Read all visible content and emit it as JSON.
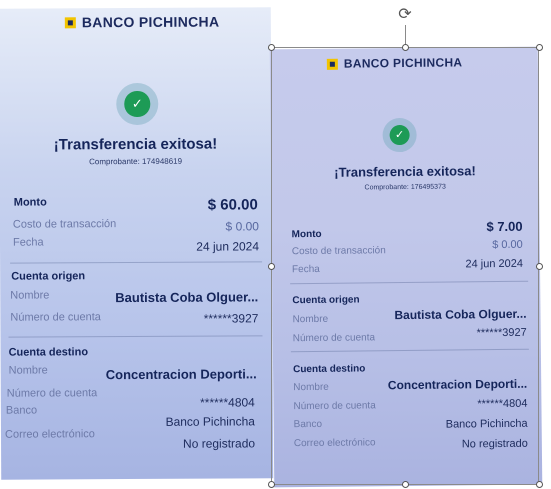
{
  "receipts": [
    {
      "bank_name": "BANCO PICHINCHA",
      "title": "¡Transferencia exitosa!",
      "comprobante": "Comprobante: 174948619",
      "monto_label": "Monto",
      "monto_value": "$ 60.00",
      "costo_label": "Costo de transacción",
      "costo_value": "$ 0.00",
      "fecha_label": "Fecha",
      "fecha_value": "24 jun 2024",
      "origen_title": "Cuenta origen",
      "origen_nombre_label": "Nombre",
      "origen_nombre_value": "Bautista  Coba Olguer...",
      "origen_numero_label": "Número de cuenta",
      "origen_numero_value": "******3927",
      "destino_title": "Cuenta destino",
      "destino_nombre_label": "Nombre",
      "destino_nombre_value": "Concentracion Deporti...",
      "destino_numero_label": "Número de cuenta",
      "destino_numero_value": "******4804",
      "banco_label": "Banco",
      "banco_value": "Banco Pichincha",
      "correo_label": "Correo electrónico",
      "correo_value": "No registrado"
    },
    {
      "bank_name": "BANCO PICHINCHA",
      "title": "¡Transferencia exitosa!",
      "comprobante": "Comprobante: 176495373",
      "monto_label": "Monto",
      "monto_value": "$ 7.00",
      "costo_label": "Costo de transacción",
      "costo_value": "$ 0.00",
      "fecha_label": "Fecha",
      "fecha_value": "24 jun 2024",
      "origen_title": "Cuenta origen",
      "origen_nombre_label": "Nombre",
      "origen_nombre_value": "Bautista  Coba Olguer...",
      "origen_numero_label": "Número de cuenta",
      "origen_numero_value": "******3927",
      "destino_title": "Cuenta destino",
      "destino_nombre_label": "Nombre",
      "destino_nombre_value": "Concentracion Deporti...",
      "destino_numero_label": "Número de cuenta",
      "destino_numero_value": "******4804",
      "banco_label": "Banco",
      "banco_value": "Banco Pichincha",
      "correo_label": "Correo electrónico",
      "correo_value": "No registrado"
    }
  ],
  "icons": {
    "success": "check-icon",
    "rotate": "rotate-handle-icon"
  },
  "colors": {
    "success_green": "#1d9b56",
    "brand_yellow": "#f2c400",
    "brand_navy": "#1c2a5e"
  },
  "glyphs": {
    "check": "✓",
    "rotate": "⟳"
  }
}
